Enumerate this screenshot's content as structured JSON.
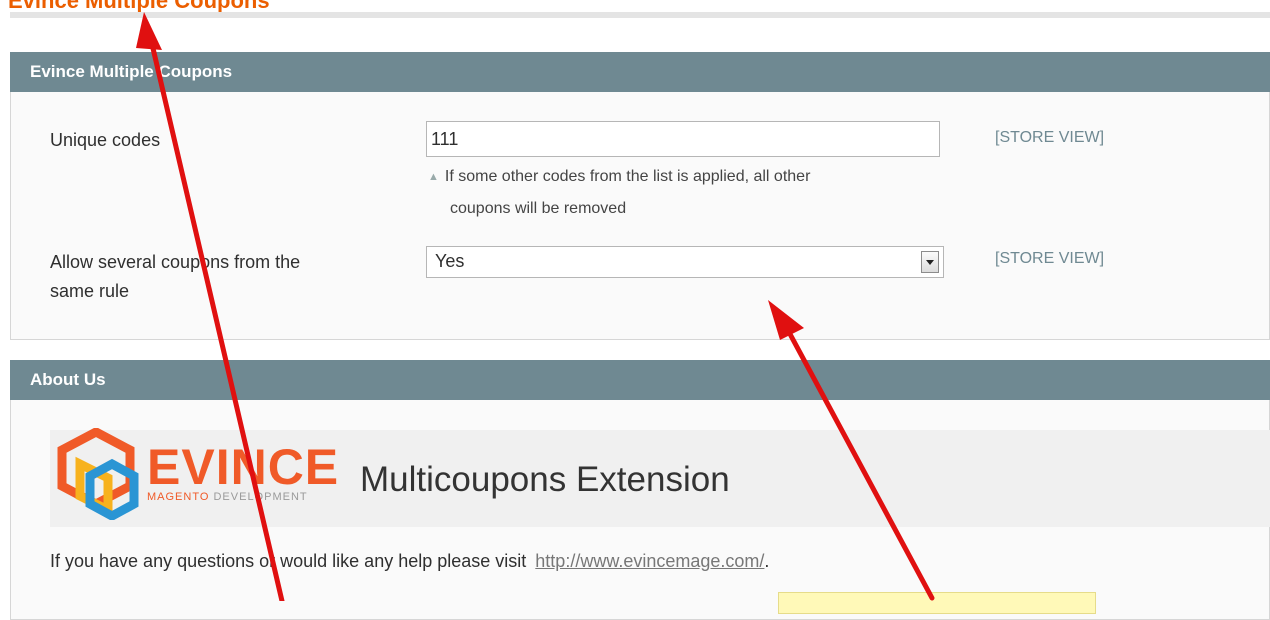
{
  "page_header": {
    "title": "Evince Multiple Coupons"
  },
  "coupons_section": {
    "title": "Evince Multiple Coupons",
    "unique_codes": {
      "label": "Unique codes",
      "value": "111",
      "hint_line1": "If some other codes from the list is applied, all other",
      "hint_line2": "coupons will be removed",
      "scope": "[STORE VIEW]"
    },
    "allow_several": {
      "label_line1": "Allow several coupons from the",
      "label_line2": "same rule",
      "value": "Yes",
      "scope": "[STORE VIEW]"
    }
  },
  "about_section": {
    "title": "About Us",
    "logo_word": "EVINCE",
    "logo_sub_a": "MAGENTO",
    "logo_sub_b": "DEVELOPMENT",
    "banner_title": "Multicoupons Extension",
    "text": "If you have any questions or would like any help please visit",
    "link": "http://www.evincemage.com/",
    "text_end": "."
  },
  "colors": {
    "section_header": "#6f8992",
    "brand_orange": "#f05a28",
    "arrow_red": "#e01010"
  },
  "icons": [
    "evince-logo-icon",
    "select-dropdown-icon",
    "hint-arrow-icon"
  ]
}
